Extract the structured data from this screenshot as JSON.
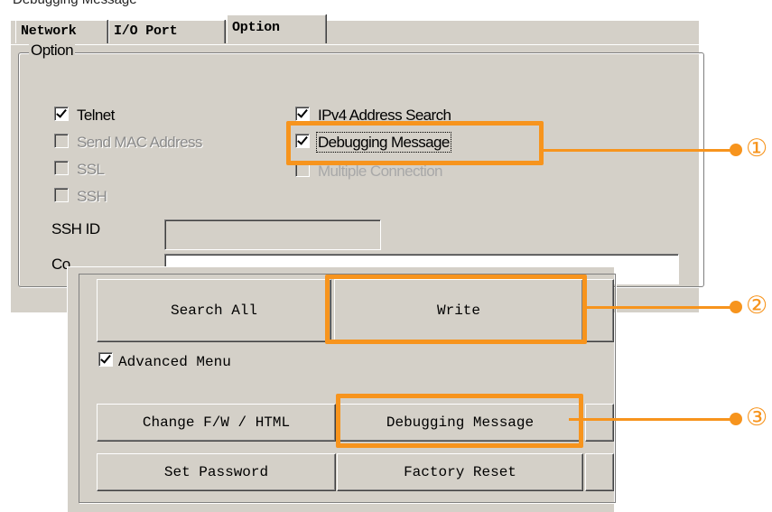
{
  "header": {
    "clipped_text": "Debugging Message"
  },
  "tabs": [
    {
      "label": "Network",
      "active": false
    },
    {
      "label": "I/O Port",
      "active": false
    },
    {
      "label": "Option",
      "active": true
    }
  ],
  "option_group": {
    "legend": "Option",
    "left_checks": [
      {
        "label": "Telnet",
        "checked": true,
        "enabled": true
      },
      {
        "label": "Send MAC Address",
        "checked": false,
        "enabled": false
      },
      {
        "label": "SSL",
        "checked": false,
        "enabled": false
      },
      {
        "label": "SSH",
        "checked": false,
        "enabled": false
      }
    ],
    "right_checks": [
      {
        "label": "IPv4 Address Search",
        "checked": true,
        "enabled": true
      },
      {
        "label": "Debugging Message",
        "checked": true,
        "enabled": true
      },
      {
        "label": "Multiple Connection",
        "checked": false,
        "enabled": false
      }
    ],
    "ssh_id_label": "SSH ID",
    "ssh_id_value": "",
    "comment_label": "Co",
    "comment_value": ""
  },
  "buttons": {
    "search_all": "Search All",
    "write": "Write",
    "change_fw": "Change F/W / HTML",
    "debugging_message": "Debugging Message",
    "set_password": "Set Password",
    "factory_reset": "Factory Reset"
  },
  "advanced_menu": {
    "label": "Advanced Menu",
    "checked": true
  },
  "markers": [
    "①",
    "②",
    "③"
  ],
  "colors": {
    "highlight": "#f7941d",
    "window_bg": "#d4d0c8"
  }
}
